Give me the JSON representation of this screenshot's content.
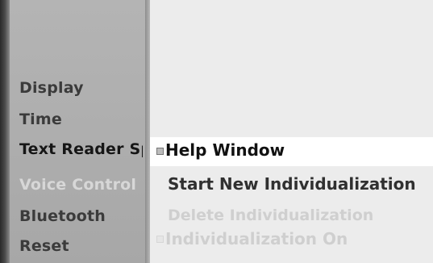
{
  "left_menu": {
    "items": [
      {
        "label": "Display",
        "state": "normal"
      },
      {
        "label": "Time",
        "state": "normal"
      },
      {
        "label": "Text Reader Sp",
        "state": "active"
      },
      {
        "label": "Voice Control",
        "state": "disabled"
      },
      {
        "label": "Bluetooth",
        "state": "normal"
      },
      {
        "label": "Reset",
        "state": "normal"
      }
    ]
  },
  "submenu": {
    "items": [
      {
        "label": "Help Window",
        "state": "selected",
        "indicator": "checkbox-icon"
      },
      {
        "label": "Start New Individualization",
        "state": "normal"
      },
      {
        "label": "Delete Individualization",
        "state": "disabled"
      },
      {
        "label": "Individualization On",
        "state": "disabled",
        "indicator": "checkbox-icon"
      }
    ]
  },
  "colors": {
    "left_panel": "#aeaeae",
    "right_panel": "#ececec",
    "highlight": "#ffffff",
    "text": "#3b3b3b",
    "disabled_text": "#d7d7d7"
  }
}
